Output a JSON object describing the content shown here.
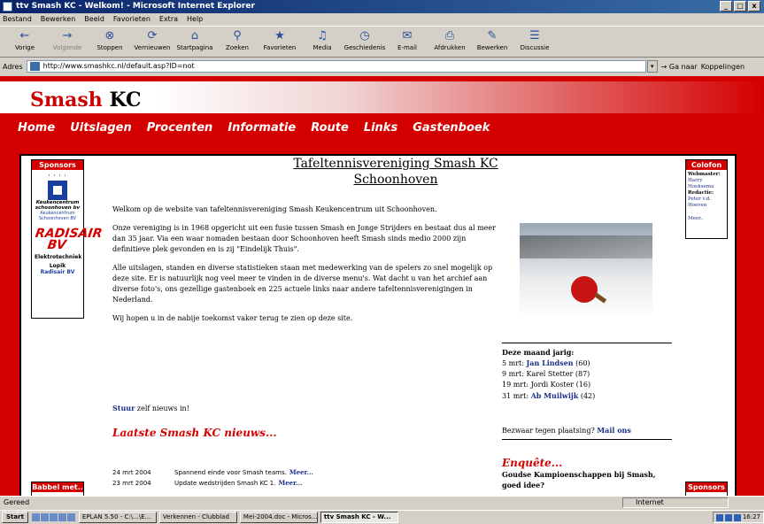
{
  "window": {
    "title": "ttv Smash KC - Welkom! - Microsoft Internet Explorer",
    "min_label": "_",
    "max_label": "□",
    "close_label": "x"
  },
  "menubar": [
    "Bestand",
    "Bewerken",
    "Beeld",
    "Favorieten",
    "Extra",
    "Help"
  ],
  "toolbar": [
    {
      "label": "Vorige",
      "icon": "back-arrow-icon",
      "glyph": "←"
    },
    {
      "label": "Volgende",
      "icon": "forward-arrow-icon",
      "glyph": "→"
    },
    {
      "label": "Stoppen",
      "icon": "stop-icon",
      "glyph": "⊗"
    },
    {
      "label": "Vernieuwen",
      "icon": "refresh-icon",
      "glyph": "⟳"
    },
    {
      "label": "Startpagina",
      "icon": "home-icon",
      "glyph": "⌂"
    },
    {
      "label": "Zoeken",
      "icon": "search-icon",
      "glyph": "⚲"
    },
    {
      "label": "Favorieten",
      "icon": "favorites-icon",
      "glyph": "★"
    },
    {
      "label": "Media",
      "icon": "media-icon",
      "glyph": "♫"
    },
    {
      "label": "Geschiedenis",
      "icon": "history-icon",
      "glyph": "◷"
    },
    {
      "label": "E-mail",
      "icon": "mail-icon",
      "glyph": "✉"
    },
    {
      "label": "Afdrukken",
      "icon": "print-icon",
      "glyph": "⎙"
    },
    {
      "label": "Bewerken",
      "icon": "edit-icon",
      "glyph": "✎"
    },
    {
      "label": "Discussie",
      "icon": "discuss-icon",
      "glyph": "☰"
    }
  ],
  "address": {
    "label": "Adres",
    "url": "http://www.smashkc.nl/default.asp?ID=not",
    "go_label": "Ga naar",
    "links_label": "Koppelingen"
  },
  "site": {
    "logo_red": "Smash",
    "logo_black": " KC",
    "nav": [
      "Home",
      "Uitslagen",
      "Procenten",
      "Informatie",
      "Route",
      "Links",
      "Gastenboek"
    ]
  },
  "sidebar": {
    "sponsors_header": "Sponsors",
    "ad1_line1": "Keukencentrum",
    "ad1_line2": "schoonhoven bv",
    "ad1_line3": "Keukencentrum",
    "ad1_line4": "Schoonhoven BV",
    "ad2_logo": "RADISAIR BV",
    "ad2_line1": "Elektrotechniek",
    "ad2_line2": "Lopik",
    "ad2_link": "Radisair BV",
    "babbel_header": "Babbel met..",
    "colofon_header": "Colofon",
    "colofon_webmaster_label": "Webmaster:",
    "colofon_webmaster": "Harry Hoeksema",
    "colofon_redactie_label": "Redactie:",
    "colofon_redactie": "Peter v.d. Hoeven",
    "colofon_meer": "Meer..",
    "sponsors2_header": "Sponsors"
  },
  "main": {
    "title_line1": "Tafeltennisvereniging Smash KC",
    "title_line2": "Schoonhoven",
    "p1": "Welkom op de website van tafeltennisvereniging Smash Keukencentrum uit Schoonhoven.",
    "p2": "Onze vereniging is in 1968 opgericht uit een fusie tussen Smash en Jonge Strijders en bestaat dus al meer dan 35 jaar. Via een waar nomaden bestaan door Schoonhoven heeft Smash sinds medio 2000 zijn definitieve plek gevonden en is zij \"Eindelijk Thuis\".",
    "p3": "Alle uitslagen, standen en diverse statistieken staan met medewerking van de spelers zo snel mogelijk op deze site. Er is natuurlijk nog veel meer te vinden in de diverse menu's. Wat dacht u van het archief aan diverse foto's, ons gezellige gastenboek en 225 actuele links naar andere tafeltennisverenigingen in Nederland.",
    "p4": "Wij hopen u in de nabije toekomst vaker terug te zien op deze site.",
    "stuur_link": "Stuur",
    "stuur_rest": " zelf nieuws in!",
    "news_heading": "Laatste Smash KC nieuws...",
    "news": [
      {
        "date": "24 mrt 2004",
        "text": "Spannend einde voor Smash teams.",
        "more": "Meer..."
      },
      {
        "date": "23 mrt 2004",
        "text": "Update wedstrijden Smash KC 1.",
        "more": "Meer..."
      }
    ],
    "bday_heading": "Deze maand jarig:",
    "bdays": [
      {
        "date": "5 mrt:",
        "name": "Jan Lindsen",
        "age": "(60)",
        "linked": true
      },
      {
        "date": "9 mrt:",
        "name": "Karel Stetter",
        "age": "(87)",
        "linked": false
      },
      {
        "date": "19 mrt:",
        "name": "Jordi Koster",
        "age": "(16)",
        "linked": false
      },
      {
        "date": "31 mrt:",
        "name": "Ab Muilwijk",
        "age": "(42)",
        "linked": true
      }
    ],
    "bezwaar_text": "Bezwaar tegen plaatsing? ",
    "bezwaar_link": "Mail ons",
    "enquete_heading": "Enquête...",
    "enquete_question": "Goudse Kampioenschappen bij Smash, goed idee?"
  },
  "statusbar": {
    "text": "Gereed",
    "zone": "Internet"
  },
  "taskbar": {
    "start": "Start",
    "tasks": [
      "EPLAN 5.50 - C:\\...\\E...",
      "Verkennen - Clubblad",
      "Mei-2004.doc - Micros...",
      "ttv Smash KC - W..."
    ],
    "clock": "16:27"
  },
  "colors": {
    "brand_red": "#d40000",
    "link_blue": "#1a2f8a",
    "title_bar": "#0a246a"
  }
}
